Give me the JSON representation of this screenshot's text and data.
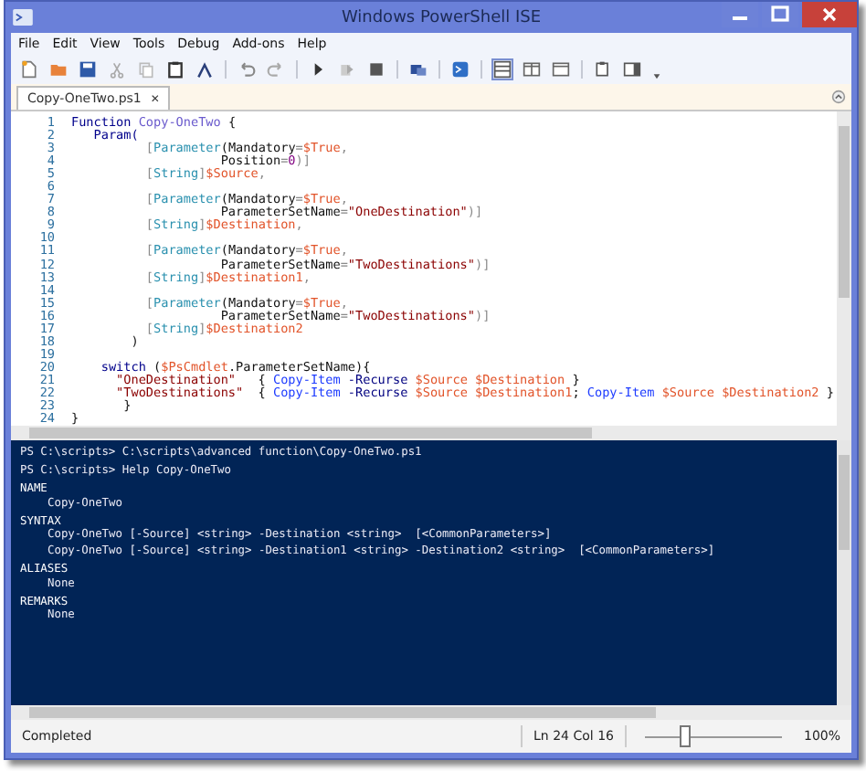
{
  "window": {
    "title": "Windows PowerShell ISE"
  },
  "menu": [
    "File",
    "Edit",
    "View",
    "Tools",
    "Debug",
    "Add-ons",
    "Help"
  ],
  "tabs": [
    {
      "label": "Copy-OneTwo.ps1",
      "close": "✕",
      "selected": true
    }
  ],
  "editor": {
    "lines": [
      {
        "number": "1",
        "tokens": [
          {
            "text": "Function ",
            "kind": "keyword"
          },
          {
            "text": "Copy-OneTwo",
            "kind": "function"
          },
          {
            "text": " {",
            "kind": "plain"
          }
        ]
      },
      {
        "number": "2",
        "tokens": [
          {
            "text": "   Param(",
            "kind": "keyword"
          }
        ]
      },
      {
        "number": "3",
        "tokens": [
          {
            "text": "          [",
            "kind": "op"
          },
          {
            "text": "Parameter",
            "kind": "type"
          },
          {
            "text": "(Mandatory",
            "kind": "plain"
          },
          {
            "text": "=",
            "kind": "op"
          },
          {
            "text": "$True",
            "kind": "variable"
          },
          {
            "text": ",",
            "kind": "op"
          }
        ]
      },
      {
        "number": "4",
        "tokens": [
          {
            "text": "                    Position",
            "kind": "plain"
          },
          {
            "text": "=",
            "kind": "op"
          },
          {
            "text": "0",
            "kind": "number"
          },
          {
            "text": ")]",
            "kind": "op"
          }
        ]
      },
      {
        "number": "5",
        "tokens": [
          {
            "text": "          [",
            "kind": "op"
          },
          {
            "text": "String",
            "kind": "type"
          },
          {
            "text": "]",
            "kind": "op"
          },
          {
            "text": "$Source",
            "kind": "variable"
          },
          {
            "text": ",",
            "kind": "op"
          }
        ]
      },
      {
        "number": "6"
      },
      {
        "number": "7",
        "tokens": [
          {
            "text": "          [",
            "kind": "op"
          },
          {
            "text": "Parameter",
            "kind": "type"
          },
          {
            "text": "(Mandatory",
            "kind": "plain"
          },
          {
            "text": "=",
            "kind": "op"
          },
          {
            "text": "$True",
            "kind": "variable"
          },
          {
            "text": ",",
            "kind": "op"
          }
        ]
      },
      {
        "number": "8",
        "tokens": [
          {
            "text": "                    ParameterSetName",
            "kind": "plain"
          },
          {
            "text": "=",
            "kind": "op"
          },
          {
            "text": "\"OneDestination\"",
            "kind": "string"
          },
          {
            "text": ")]",
            "kind": "op"
          }
        ]
      },
      {
        "number": "9",
        "tokens": [
          {
            "text": "          [",
            "kind": "op"
          },
          {
            "text": "String",
            "kind": "type"
          },
          {
            "text": "]",
            "kind": "op"
          },
          {
            "text": "$Destination",
            "kind": "variable"
          },
          {
            "text": ",",
            "kind": "op"
          }
        ]
      },
      {
        "number": "10"
      },
      {
        "number": "11",
        "tokens": [
          {
            "text": "          [",
            "kind": "op"
          },
          {
            "text": "Parameter",
            "kind": "type"
          },
          {
            "text": "(Mandatory",
            "kind": "plain"
          },
          {
            "text": "=",
            "kind": "op"
          },
          {
            "text": "$True",
            "kind": "variable"
          },
          {
            "text": ",",
            "kind": "op"
          }
        ]
      },
      {
        "number": "12",
        "tokens": [
          {
            "text": "                    ParameterSetName",
            "kind": "plain"
          },
          {
            "text": "=",
            "kind": "op"
          },
          {
            "text": "\"TwoDestinations\"",
            "kind": "string"
          },
          {
            "text": ")]",
            "kind": "op"
          }
        ]
      },
      {
        "number": "13",
        "tokens": [
          {
            "text": "          [",
            "kind": "op"
          },
          {
            "text": "String",
            "kind": "type"
          },
          {
            "text": "]",
            "kind": "op"
          },
          {
            "text": "$Destination1",
            "kind": "variable"
          },
          {
            "text": ",",
            "kind": "op"
          }
        ]
      },
      {
        "number": "14"
      },
      {
        "number": "15",
        "tokens": [
          {
            "text": "          [",
            "kind": "op"
          },
          {
            "text": "Parameter",
            "kind": "type"
          },
          {
            "text": "(Mandatory",
            "kind": "plain"
          },
          {
            "text": "=",
            "kind": "op"
          },
          {
            "text": "$True",
            "kind": "variable"
          },
          {
            "text": ",",
            "kind": "op"
          }
        ]
      },
      {
        "number": "16",
        "tokens": [
          {
            "text": "                    ParameterSetName",
            "kind": "plain"
          },
          {
            "text": "=",
            "kind": "op"
          },
          {
            "text": "\"TwoDestinations\"",
            "kind": "string"
          },
          {
            "text": ")]",
            "kind": "op"
          }
        ]
      },
      {
        "number": "17",
        "tokens": [
          {
            "text": "          [",
            "kind": "op"
          },
          {
            "text": "String",
            "kind": "type"
          },
          {
            "text": "]",
            "kind": "op"
          },
          {
            "text": "$Destination2",
            "kind": "variable"
          }
        ]
      },
      {
        "number": "18",
        "tokens": [
          {
            "text": "        )",
            "kind": "plain"
          }
        ]
      },
      {
        "number": "19"
      },
      {
        "number": "20",
        "tokens": [
          {
            "text": "    switch ",
            "kind": "keyword"
          },
          {
            "text": "(",
            "kind": "plain"
          },
          {
            "text": "$PsCmdlet",
            "kind": "variable"
          },
          {
            "text": ".ParameterSetName){",
            "kind": "plain"
          }
        ]
      },
      {
        "number": "21",
        "tokens": [
          {
            "text": "      \"OneDestination\"",
            "kind": "string"
          },
          {
            "text": "   { ",
            "kind": "plain"
          },
          {
            "text": "Copy-Item",
            "kind": "command"
          },
          {
            "text": " -Recurse ",
            "kind": "param"
          },
          {
            "text": "$Source $Destination",
            "kind": "variable"
          },
          {
            "text": " }",
            "kind": "plain"
          }
        ]
      },
      {
        "number": "22",
        "tokens": [
          {
            "text": "      \"TwoDestinations\"",
            "kind": "string"
          },
          {
            "text": "  { ",
            "kind": "plain"
          },
          {
            "text": "Copy-Item",
            "kind": "command"
          },
          {
            "text": " -Recurse ",
            "kind": "param"
          },
          {
            "text": "$Source $Destination1",
            "kind": "variable"
          },
          {
            "text": "; ",
            "kind": "plain"
          },
          {
            "text": "Copy-Item",
            "kind": "command"
          },
          {
            "text": " $Source $Destination2",
            "kind": "variable"
          },
          {
            "text": " }",
            "kind": "plain"
          }
        ]
      },
      {
        "number": "23",
        "tokens": [
          {
            "text": "       }",
            "kind": "plain"
          }
        ]
      },
      {
        "number": "24",
        "tokens": [
          {
            "text": "}",
            "kind": "plain"
          }
        ]
      }
    ]
  },
  "console": {
    "lines": [
      {
        "text": "PS C:\\scripts> C:\\scripts\\advanced function\\Copy-OneTwo.ps1",
        "kind": "prompt"
      },
      {
        "text": "PS C:\\scripts> Help Copy-OneTwo",
        "kind": "prompt"
      },
      {
        "text": "NAME",
        "kind": "heading"
      },
      {
        "text": "Copy-OneTwo",
        "kind": "body"
      },
      {
        "text": "SYNTAX",
        "kind": "heading"
      },
      {
        "text": "Copy-OneTwo [-Source] <string> -Destination <string>  [<CommonParameters>]",
        "kind": "body"
      },
      {
        "text": "Copy-OneTwo [-Source] <string> -Destination1 <string> -Destination2 <string>  [<CommonParameters>]",
        "kind": "body"
      },
      {
        "text": "ALIASES",
        "kind": "heading"
      },
      {
        "text": "None",
        "kind": "body"
      },
      {
        "text": "REMARKS",
        "kind": "heading"
      },
      {
        "text": "None",
        "kind": "body"
      }
    ]
  },
  "status_bar": {
    "status": "Completed",
    "position": "Ln 24  Col 16",
    "zoom": {
      "level": 0.28
    },
    "zoom_text": "100%"
  }
}
